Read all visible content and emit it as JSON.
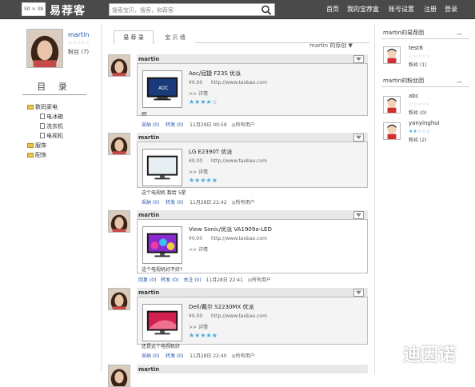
{
  "header": {
    "logo_box": "50 × 38",
    "logo_text": "易荐客",
    "search_placeholder": "搜索宝贝，搜客，和荐客",
    "nav": [
      "首页",
      "我的宝荐盒",
      "账号设置",
      "注册",
      "登录"
    ]
  },
  "profile": {
    "name": "martin",
    "fans_label": "粉丝",
    "fans_count": "(7)"
  },
  "catalog": {
    "title": "目 录",
    "items": [
      {
        "label": "数码家电",
        "type": "folder",
        "level": 0
      },
      {
        "label": "电冰箱",
        "type": "doc",
        "level": 1
      },
      {
        "label": "洗衣机",
        "type": "doc",
        "level": 1
      },
      {
        "label": "电视机",
        "type": "doc",
        "level": 1
      },
      {
        "label": "服饰",
        "type": "folder",
        "level": 0
      },
      {
        "label": "配饰",
        "type": "folder",
        "level": 0
      }
    ]
  },
  "tabs": [
    "易 荐 录",
    "宝 贝 墙"
  ],
  "filter": "martin 的荐创 ▼",
  "posts": [
    {
      "user": "martin",
      "title": "Aoc/冠捷 F23S 优派",
      "price": "¥0.00",
      "url": "http://www.taobao.com",
      "detail": ">> 详情",
      "stars": "★★★★☆",
      "comment": "fff",
      "actions": {
        "collect": "采纳 (0)",
        "forward": "转发 (0)",
        "date": "11月29日 00:59",
        "scope": "◎所有用户"
      }
    },
    {
      "user": "martin",
      "title": "LG E2390T 优派",
      "price": "¥0.00",
      "url": "http://www.taobao.com",
      "detail": ">> 详情",
      "stars": "★★★★★",
      "comment": "这个电视机 数给 5星",
      "actions": {
        "collect": "采纳 (0)",
        "forward": "转发 (0)",
        "date": "11月28日 22:42",
        "scope": "◎所有用户"
      }
    },
    {
      "user": "martin",
      "title": "View Sonic/优派 VA1909a-LED",
      "price": "¥0.00",
      "url": "http://www.taobao.com",
      "detail": ">> 详情",
      "stars": "",
      "comment": "这个电视机好不好?",
      "actions": {
        "collect": "回复 (0)",
        "forward": "转发 (0)",
        "extra": "关注 (0)",
        "date": "11月28日 22:41",
        "scope": "◎所有用户"
      }
    },
    {
      "user": "martin",
      "title": "Dell/戴尔 S2230MX 优派",
      "price": "¥0.00",
      "url": "http://www.taobao.com",
      "detail": ">> 详情",
      "stars": "★★★★★",
      "comment": "还是这个电视机好",
      "actions": {
        "collect": "采纳 (0)",
        "forward": "转发 (0)",
        "date": "11月28日 22:40",
        "scope": "◎所有用户"
      }
    },
    {
      "user": "martin"
    }
  ],
  "right": {
    "follow_title": "martin的易荐团",
    "follow_users": [
      {
        "name": "test6",
        "fans": "粉丝 (1)"
      }
    ],
    "fans_title": "martin的粉丝团",
    "fans_users": [
      {
        "name": "abc",
        "fans": "粉丝 (0)"
      },
      {
        "name": "yanyinghui",
        "fans": "粉丝 (2)"
      }
    ]
  },
  "watermark": "迪因诺",
  "colors": {
    "topbar": "#4a4a4a",
    "link": "#2255aa",
    "star": "#4aa8d8"
  }
}
